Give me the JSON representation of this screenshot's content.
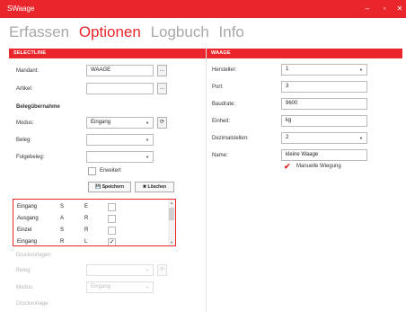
{
  "window": {
    "title": "SWaage",
    "minimize": "–",
    "maximize": "▫",
    "close": "✕"
  },
  "nav": {
    "tabs": [
      "Erfassen",
      "Optionen",
      "Logbuch",
      "Info"
    ],
    "active": "Optionen"
  },
  "left": {
    "header": "SELECTLINE",
    "mandant": {
      "label": "Mandant:",
      "value": "WAAGE",
      "button": "..."
    },
    "artikel": {
      "label": "Artikel:",
      "value": "",
      "button": "..."
    },
    "beleg_section": "Belegübernahme",
    "modus": {
      "label": "Modus:",
      "value": "Eingang"
    },
    "beleg": {
      "label": "Beleg:",
      "value": ""
    },
    "folgebeleg": {
      "label": "Folgebeleg:",
      "value": ""
    },
    "erweitert": {
      "label": "Erweitert",
      "checked": false
    },
    "save_button": "Speichern",
    "delete_button": "Löschen",
    "list": [
      {
        "name": "Eingang",
        "a": "S",
        "b": "E",
        "checked": false
      },
      {
        "name": "Ausgang",
        "a": "A",
        "b": "R",
        "checked": false
      },
      {
        "name": "Einzel",
        "a": "S",
        "b": "R",
        "checked": false
      },
      {
        "name": "Eingang",
        "a": "R",
        "b": "L",
        "checked": true
      }
    ],
    "druck_section": "Druckvorlagen",
    "druck_beleg": {
      "label": "Beleg:",
      "value": ""
    },
    "druck_modus": {
      "label": "Modus:",
      "value": "Eingang"
    },
    "druck_vorlage": {
      "label": "Druckvorlage:"
    }
  },
  "right": {
    "header": "WAAGE",
    "hersteller": {
      "label": "Hersteller:",
      "value": "1"
    },
    "port": {
      "label": "Port:",
      "value": "3"
    },
    "baudrate": {
      "label": "Baudrate:",
      "value": "9600"
    },
    "einheit": {
      "label": "Einheit:",
      "value": "kg"
    },
    "dezimal": {
      "label": "Dezimalstellen:",
      "value": "2"
    },
    "name": {
      "label": "Name:",
      "value": "kleine Waage"
    },
    "manuelle": {
      "label": "Manuelle Wiegung",
      "checked": true
    }
  },
  "icons": {
    "refresh": "refresh-icon",
    "save": "save-icon",
    "delete": "delete-icon",
    "dropdown": "chevron-down-icon"
  },
  "colors": {
    "accent": "#e8262b",
    "inactive_tab": "#a8a8a8"
  }
}
